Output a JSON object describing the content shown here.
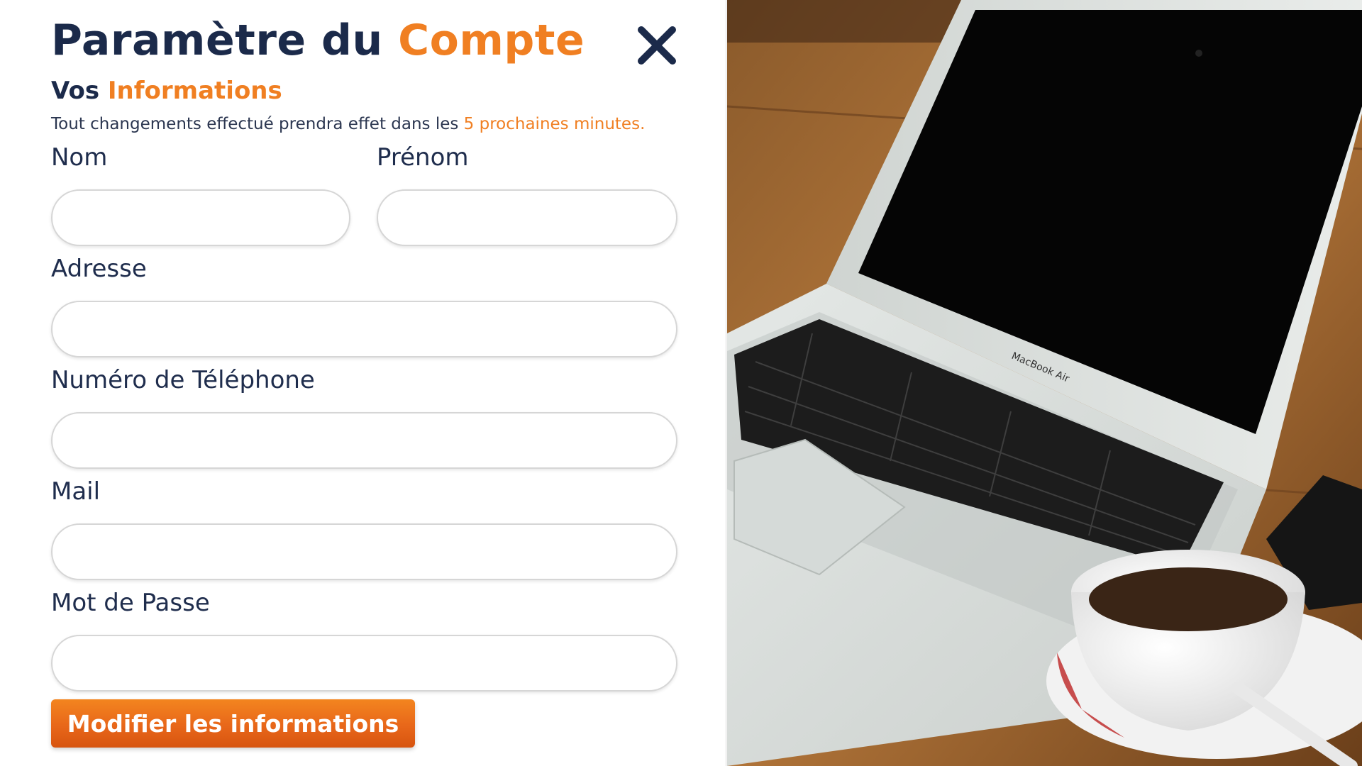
{
  "header": {
    "title_main": "Paramètre du ",
    "title_accent": "Compte",
    "close_icon": "close-x-icon"
  },
  "section": {
    "subtitle_main": "Vos ",
    "subtitle_accent": "Informations",
    "notice_main": "Tout changements effectué prendra effet dans les ",
    "notice_accent": "5 prochaines minutes."
  },
  "form": {
    "nom": {
      "label": "Nom",
      "value": ""
    },
    "prenom": {
      "label": "Prénom",
      "value": ""
    },
    "adresse": {
      "label": "Adresse",
      "value": ""
    },
    "telephone": {
      "label": "Numéro de Téléphone",
      "value": ""
    },
    "mail": {
      "label": "Mail",
      "value": ""
    },
    "password": {
      "label": "Mot de Passe",
      "value": ""
    },
    "submit_label": "Modifier les informations"
  },
  "photo": {
    "laptop_brand": "MacBook Air"
  },
  "colors": {
    "navy": "#1b2a4a",
    "accent_orange": "#f07f22",
    "button_orange": "#e8671a"
  }
}
